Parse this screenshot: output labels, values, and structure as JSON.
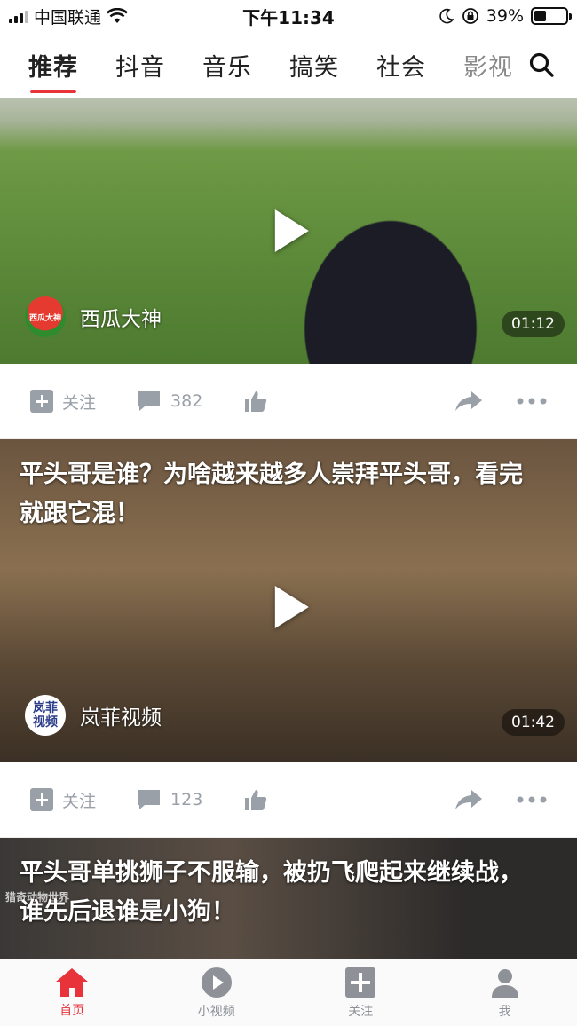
{
  "status_bar": {
    "carrier": "中国联通",
    "time": "下午11:34",
    "battery": "39%",
    "battery_level": 0.39
  },
  "top_nav": {
    "tabs": [
      {
        "label": "推荐",
        "active": true
      },
      {
        "label": "抖音",
        "active": false
      },
      {
        "label": "音乐",
        "active": false
      },
      {
        "label": "搞笑",
        "active": false
      },
      {
        "label": "社会",
        "active": false
      },
      {
        "label": "影视",
        "active": false
      }
    ],
    "search_icon": "search-icon",
    "accent": "#e8333b"
  },
  "feed": [
    {
      "title": "",
      "author": "西瓜大神",
      "avatar_text": "西瓜大神",
      "duration": "01:12",
      "follow_label": "关注",
      "comments": "382"
    },
    {
      "title": "平头哥是谁？为啥越来越多人崇拜平头哥，看完就跟它混！",
      "author": "岚菲视频",
      "avatar_text": "岚菲视频",
      "duration": "01:42",
      "follow_label": "关注",
      "comments": "123"
    },
    {
      "title": "平头哥单挑狮子不服输，被扔飞爬起来继续战，谁先后退谁是小狗！",
      "watermark": "猎奇动物世界"
    }
  ],
  "bottom_nav": {
    "items": [
      {
        "label": "首页",
        "icon": "home-icon",
        "active": true
      },
      {
        "label": "小视频",
        "icon": "play-circle-icon",
        "active": false
      },
      {
        "label": "关注",
        "icon": "plus-square-icon",
        "active": false
      },
      {
        "label": "我",
        "icon": "user-icon",
        "active": false
      }
    ]
  }
}
